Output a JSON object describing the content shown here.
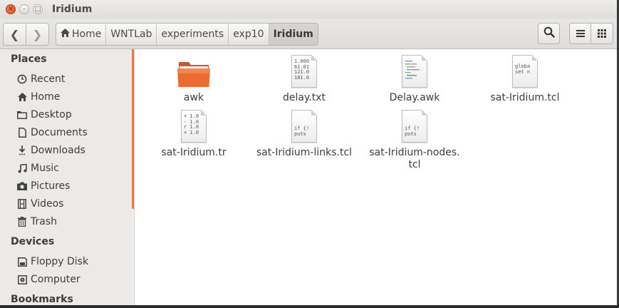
{
  "window": {
    "title": "Iridium"
  },
  "breadcrumbs": [
    "Home",
    "WNTLab",
    "experiments",
    "exp10",
    "Iridium"
  ],
  "sidebar": {
    "places_header": "Places",
    "places": [
      {
        "label": "Recent",
        "icon": "clock-icon"
      },
      {
        "label": "Home",
        "icon": "home-icon"
      },
      {
        "label": "Desktop",
        "icon": "folder-icon"
      },
      {
        "label": "Documents",
        "icon": "document-icon"
      },
      {
        "label": "Downloads",
        "icon": "download-icon"
      },
      {
        "label": "Music",
        "icon": "music-icon"
      },
      {
        "label": "Pictures",
        "icon": "camera-icon"
      },
      {
        "label": "Videos",
        "icon": "film-icon"
      },
      {
        "label": "Trash",
        "icon": "trash-icon"
      }
    ],
    "devices_header": "Devices",
    "devices": [
      {
        "label": "Floppy Disk",
        "icon": "floppy-icon"
      },
      {
        "label": "Computer",
        "icon": "computer-icon"
      }
    ],
    "bookmarks_header": "Bookmarks"
  },
  "files": [
    {
      "name": "awk",
      "type": "folder"
    },
    {
      "name": "delay.txt",
      "type": "text",
      "preview": "1.000\n61.01\n121.0\n181.0"
    },
    {
      "name": "Delay.awk",
      "type": "script"
    },
    {
      "name": "sat-Iridium.tcl",
      "type": "text",
      "preview": "globa\nset n"
    },
    {
      "name": "sat-Iridium.tr",
      "type": "text",
      "preview": "+ 1.0\n- 1.0\nr 1.0\n+ 1.0"
    },
    {
      "name": "sat-Iridium-links.tcl",
      "type": "text",
      "preview": "if {!\nputs"
    },
    {
      "name": "sat-Iridium-nodes.\ntcl",
      "type": "text",
      "preview": "if {!\nputs"
    }
  ],
  "colors": {
    "accent": "#f07746",
    "close": "#df4a1d",
    "folder": "#e8662a"
  }
}
